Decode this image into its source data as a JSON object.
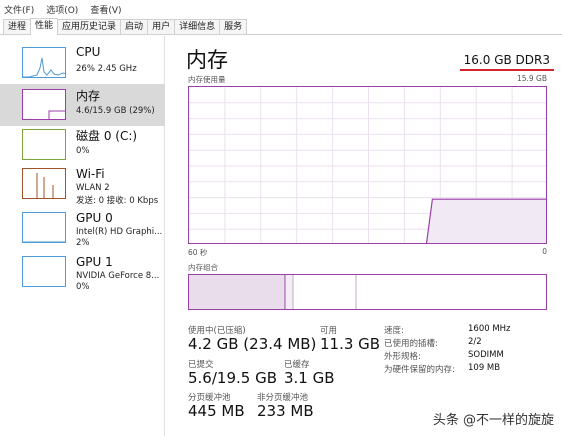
{
  "menu": [
    "文件(F)",
    "选项(O)",
    "查看(V)"
  ],
  "tabs": [
    {
      "label": "进程"
    },
    {
      "label": "性能",
      "active": true
    },
    {
      "label": "应用历史记录"
    },
    {
      "label": "启动"
    },
    {
      "label": "用户"
    },
    {
      "label": "详细信息"
    },
    {
      "label": "服务"
    }
  ],
  "sidebar": {
    "items": [
      {
        "title": "CPU",
        "line1": "26% 2.45 GHz",
        "line2": ""
      },
      {
        "title": "内存",
        "line1": "4.6/15.9 GB (29%)",
        "line2": ""
      },
      {
        "title": "磁盘 0 (C:)",
        "line1": "0%",
        "line2": ""
      },
      {
        "title": "Wi-Fi",
        "line1": "WLAN 2",
        "line2": "发送: 0 接收: 0 Kbps"
      },
      {
        "title": "GPU 0",
        "line1": "Intel(R) HD Graphi...",
        "line2": "2%"
      },
      {
        "title": "GPU 1",
        "line1": "NVIDIA GeForce 8...",
        "line2": "0%"
      }
    ]
  },
  "main": {
    "title": "内存",
    "spec": "16.0 GB DDR3",
    "usage_label": "内存使用量",
    "usage_max": "15.9 GB",
    "time_left": "60 秒",
    "time_right": "0",
    "composition_label": "内存组合",
    "usage_history_pct": [
      0,
      0,
      0,
      0,
      0,
      0,
      0,
      0,
      0,
      0,
      0,
      0,
      0,
      0,
      0,
      0,
      0,
      0,
      0,
      0,
      0,
      0,
      0,
      0,
      0,
      0,
      0,
      0,
      0,
      0,
      0,
      0,
      0,
      0,
      0,
      0,
      0,
      0,
      0,
      0,
      29,
      29,
      29,
      29,
      29,
      29,
      29,
      29,
      29,
      29,
      29,
      29,
      29,
      29,
      29,
      29,
      29,
      29,
      29,
      29
    ]
  },
  "stats": {
    "in_use_label": "使用中(已压缩)",
    "in_use_value": "4.2 GB (23.4 MB)",
    "available_label": "可用",
    "available_value": "11.3 GB",
    "committed_label": "已提交",
    "committed_value": "5.6/19.5 GB",
    "cached_label": "已缓存",
    "cached_value": "3.1 GB",
    "paged_label": "分页缓冲池",
    "paged_value": "445 MB",
    "nonpaged_label": "非分页缓冲池",
    "nonpaged_value": "233 MB"
  },
  "info": [
    {
      "label": "速度:",
      "value": "1600 MHz"
    },
    {
      "label": "已使用的插槽:",
      "value": "2/2"
    },
    {
      "label": "外形规格:",
      "value": "SODIMM"
    },
    {
      "label": "为硬件保留的内存:",
      "value": "109 MB"
    }
  ],
  "watermark": "头条 @不一样的旋旋",
  "colors": {
    "memory_accent": "#9b3fa8",
    "cpu_accent": "#4f9ad8",
    "wifi_accent": "#a0522d",
    "selected_bg": "#d9d9d9",
    "spec_underline": "#d6232f"
  }
}
